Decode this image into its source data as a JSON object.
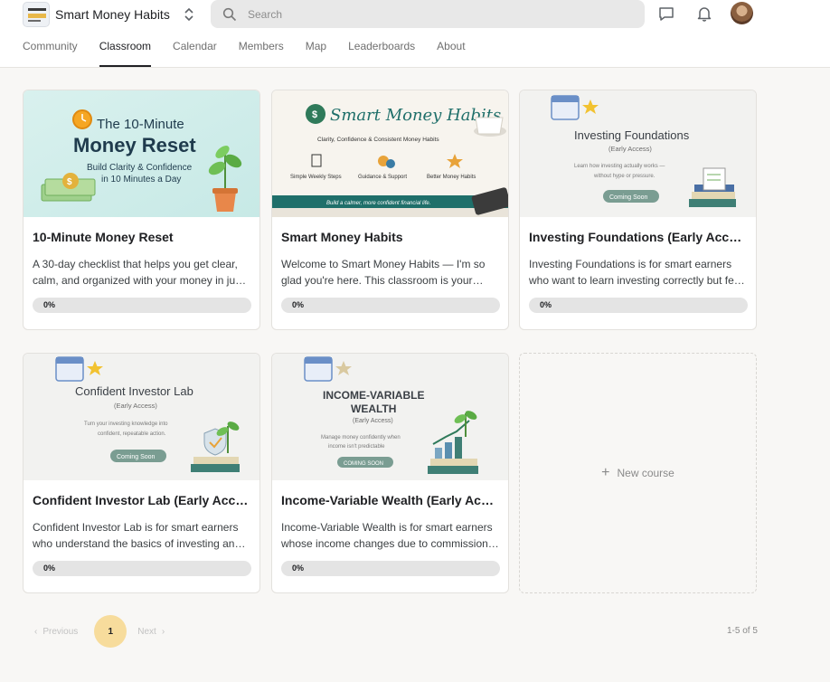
{
  "header": {
    "brand_name": "Smart Money Habits",
    "logo_text": "SMART MONEY HABITS",
    "search_placeholder": "Search",
    "icons": [
      "chat-icon",
      "bell-icon"
    ]
  },
  "tabs": [
    {
      "label": "Community",
      "active": false
    },
    {
      "label": "Classroom",
      "active": true
    },
    {
      "label": "Calendar",
      "active": false
    },
    {
      "label": "Members",
      "active": false
    },
    {
      "label": "Map",
      "active": false
    },
    {
      "label": "Leaderboards",
      "active": false
    },
    {
      "label": "About",
      "active": false
    }
  ],
  "courses": [
    {
      "title": "10-Minute Money Reset",
      "desc_lines": [
        "A 30-day checklist that helps you get clear,",
        "calm, and organized with your money in just…"
      ],
      "progress_label": "0%",
      "progress": 0,
      "thumb": {
        "line1": "The 10-Minute",
        "line2": "Money Reset",
        "line3": "Build Clarity & Confidence",
        "line4": "in 10 Minutes a Day"
      }
    },
    {
      "title": "Smart Money Habits",
      "desc_lines": [
        "Welcome to Smart Money Habits — I'm so",
        "glad you're here. This classroom is your…"
      ],
      "progress_label": "0%",
      "progress": 0,
      "thumb": {
        "title": "Smart Money Habits",
        "subtitle": "Clarity, Confidence & Consistent Money Habits",
        "step1": "Simple Weekly Steps",
        "step2": "Guidance & Support",
        "step3": "Better Money Habits",
        "footer": "Build a calmer, more confident financial life."
      }
    },
    {
      "title": "Investing Foundations (Early Access)",
      "desc_lines": [
        "Investing Foundations is for smart earners",
        "who want to learn investing correctly but fe…"
      ],
      "progress_label": "0%",
      "progress": 0,
      "thumb": {
        "title": "Investing Foundations",
        "sub": "(Early Access)",
        "line1": "Learn how investing actually works —",
        "line2": "without hype or pressure.",
        "badge": "Coming Soon"
      }
    },
    {
      "title": "Confident Investor Lab (Early Access)",
      "desc_lines": [
        "Confident Investor Lab is for smart earners",
        "who understand the basics of investing and…"
      ],
      "progress_label": "0%",
      "progress": 0,
      "thumb": {
        "title": "Confident Investor Lab",
        "sub": "(Early Access)",
        "line1": "Turn your investing knowledge into",
        "line2": "confident, repeatable action.",
        "badge": "Coming Soon"
      }
    },
    {
      "title": "Income-Variable Wealth (Early Access)",
      "desc_lines": [
        "Income-Variable Wealth is for smart earners",
        "whose income changes due to commission…"
      ],
      "progress_label": "0%",
      "progress": 0,
      "thumb": {
        "title1": "INCOME-VARIABLE",
        "title2": "WEALTH",
        "sub": "(Early Access)",
        "line1": "Manage money confidently when",
        "line2": "income isn't predictable",
        "badge": "COMING SOON"
      }
    }
  ],
  "new_course_label": "New course",
  "pagination": {
    "previous": "Previous",
    "current": "1",
    "next": "Next",
    "count": "1-5 of 5"
  },
  "colors": {
    "accent": "#f7dc9c",
    "active_tab_underline": "#202124",
    "green": "#2f7a5a"
  }
}
